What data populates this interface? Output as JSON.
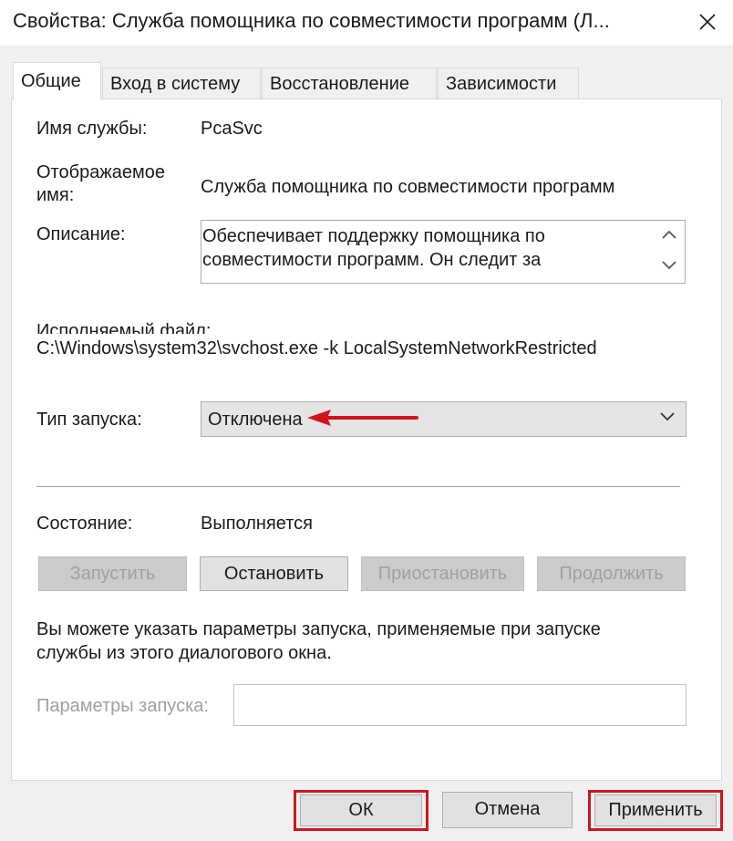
{
  "window": {
    "title": "Свойства: Служба помощника по совместимости программ (Л...",
    "close_icon": "close-icon"
  },
  "tabs": [
    {
      "label": "Общие",
      "active": true
    },
    {
      "label": "Вход в систему",
      "active": false
    },
    {
      "label": "Восстановление",
      "active": false
    },
    {
      "label": "Зависимости",
      "active": false
    }
  ],
  "general": {
    "service_name_label": "Имя службы:",
    "service_name_value": "PcaSvc",
    "display_name_label_line1": "Отображаемое",
    "display_name_label_line2": "имя:",
    "display_name_value": "Служба помощника по совместимости программ",
    "description_label": "Описание:",
    "description_line1": "Обеспечивает поддержку помощника по",
    "description_line2": "совместимости программ. Он следит за",
    "executable_label": "Исполняемый файл:",
    "executable_value": "C:\\Windows\\system32\\svchost.exe -k LocalSystemNetworkRestricted",
    "startup_type_label": "Тип запуска:",
    "startup_type_value": "Отключена",
    "status_label": "Состояние:",
    "status_value": "Выполняется",
    "buttons": {
      "start": "Запустить",
      "stop": "Остановить",
      "pause": "Приостановить",
      "resume": "Продолжить"
    },
    "hint_line1": "Вы можете указать параметры запуска, применяемые при запуске",
    "hint_line2": "службы из этого диалогового окна.",
    "start_params_label": "Параметры запуска:",
    "start_params_value": ""
  },
  "footer": {
    "ok": "ОК",
    "cancel": "Отмена",
    "apply": "Применить"
  },
  "colors": {
    "annotation_red": "#d0141e",
    "window_bg": "#f0f0f0",
    "disabled_text": "#a0a0a0"
  }
}
